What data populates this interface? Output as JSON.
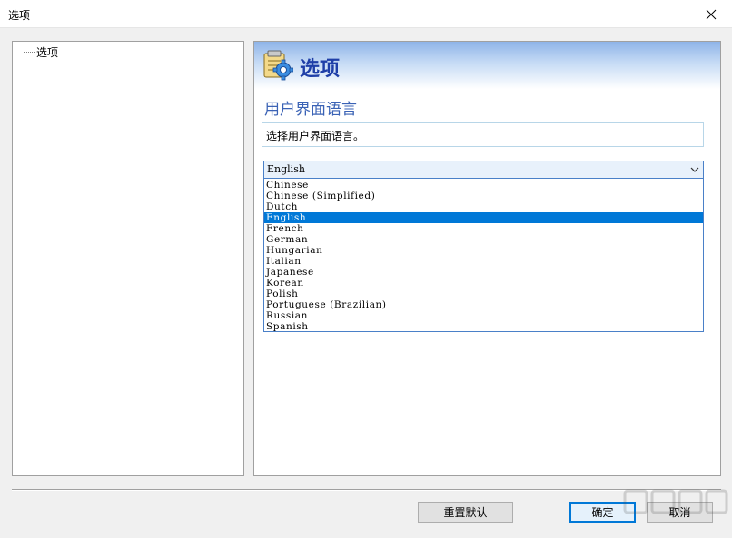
{
  "window": {
    "title": "选项"
  },
  "tree": {
    "items": [
      {
        "label": "选项"
      }
    ]
  },
  "header": {
    "title": "选项",
    "icon": "settings-gear-icon"
  },
  "section": {
    "title": "用户界面语言",
    "description": "选择用户界面语言。"
  },
  "language_select": {
    "value": "English",
    "options": [
      "Chinese",
      "Chinese (Simplified)",
      "Dutch",
      "English",
      "French",
      "German",
      "Hungarian",
      "Italian",
      "Japanese",
      "Korean",
      "Polish",
      "Portuguese (Brazilian)",
      "Russian",
      "Spanish"
    ],
    "selected_index": 3
  },
  "buttons": {
    "reset": "重置默认",
    "ok": "确定",
    "cancel": "取消"
  },
  "colors": {
    "accent": "#0078d7",
    "header_title": "#1f3fa8",
    "section_title": "#3a62b5"
  }
}
